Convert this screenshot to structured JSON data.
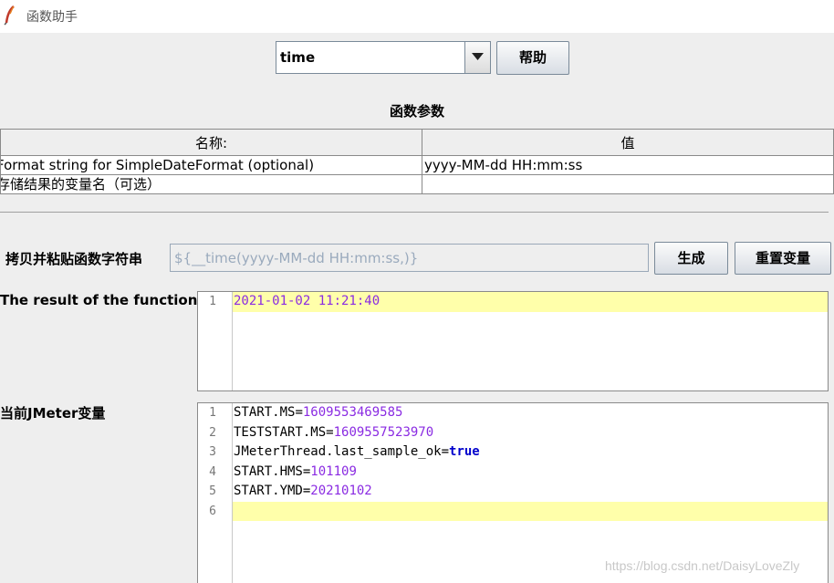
{
  "window": {
    "title": "函数助手",
    "icon": "feather-icon"
  },
  "function_selector": {
    "selected": "time",
    "icon": "chevron-down-icon"
  },
  "help_button": "帮助",
  "params_section": {
    "title": "函数参数",
    "headers": [
      "名称:",
      "值"
    ],
    "rows": [
      {
        "name": "Format string for SimpleDateFormat (optional)",
        "value": "yyyy-MM-dd HH:mm:ss"
      },
      {
        "name": "存储结果的变量名（可选）",
        "value": ""
      }
    ]
  },
  "copy_section": {
    "label": "拷贝并粘贴函数字符串",
    "value": "${__time(yyyy-MM-dd HH:mm:ss,)}",
    "generate_button": "生成",
    "reset_button": "重置变量"
  },
  "result_section": {
    "label": "The result of the function is",
    "lines": [
      {
        "num": "1",
        "text": "2021-01-02 11:21:40"
      }
    ]
  },
  "vars_section": {
    "label": "当前JMeter变量",
    "lines": [
      {
        "num": "1",
        "key": "START.MS",
        "sep": "=",
        "val": "1609553469585"
      },
      {
        "num": "2",
        "key": "TESTSTART.MS",
        "sep": "=",
        "val": "1609557523970"
      },
      {
        "num": "3",
        "key": "JMeterThread.last_sample_ok",
        "sep": "=",
        "val": "true"
      },
      {
        "num": "4",
        "key": "START.HMS",
        "sep": "=",
        "val": "101109"
      },
      {
        "num": "5",
        "key": "START.YMD",
        "sep": "=",
        "val": "20210102"
      },
      {
        "num": "6",
        "key": "",
        "sep": "",
        "val": ""
      }
    ]
  },
  "watermark": "https://blog.csdn.net/DaisyLoveZly",
  "colors": {
    "highlight": "#ffffaa",
    "number": "#8a2be2",
    "keyword": "#0000cc"
  }
}
